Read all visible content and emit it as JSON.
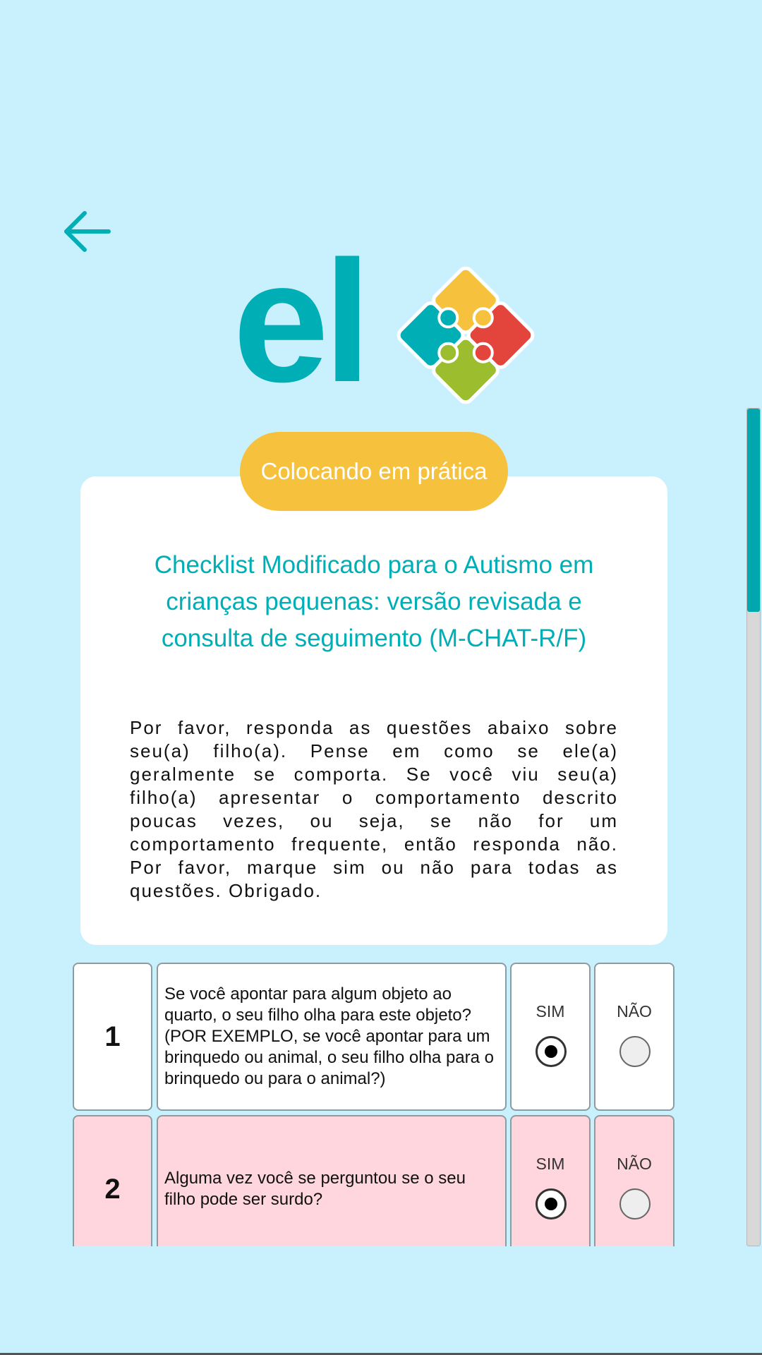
{
  "header": {
    "back_icon": "arrow-left-icon",
    "logo_text": "el",
    "logo_icon": "puzzle-icon"
  },
  "colors": {
    "accent": "#00aeb6",
    "pill": "#f6c23e",
    "puzzle": [
      "#f6c23e",
      "#e3453c",
      "#9bbd2e",
      "#00aeb6"
    ],
    "row_alt": "#ffd6de"
  },
  "card": {
    "badge": "Colocando em prática",
    "title": "Checklist Modificado para o Autismo em crianças pequenas: versão revisada e consulta de seguimento (M-CHAT-R/F)",
    "body": "Por favor, responda as questões abaixo sobre seu(a) filho(a). Pense em como se ele(a) geralmente se comporta. Se você viu seu(a) filho(a) apresentar o comportamento descrito poucas vezes, ou seja, se não for um comportamento frequente, então responda não. Por favor, marque sim ou não para todas as questões. Obrigado."
  },
  "questions": [
    {
      "number": "1",
      "text": "Se você apontar para algum objeto ao quarto, o seu filho olha para este objeto? (POR EXEMPLO, se você apontar para um brinquedo ou animal, o seu filho olha para o brinquedo ou para o animal?)",
      "yes_label": "SIM",
      "no_label": "NÃO",
      "selected": "SIM"
    },
    {
      "number": "2",
      "text": "Alguma vez você se perguntou se o seu filho pode ser surdo?",
      "yes_label": "SIM",
      "no_label": "NÃO",
      "selected": "SIM"
    }
  ]
}
